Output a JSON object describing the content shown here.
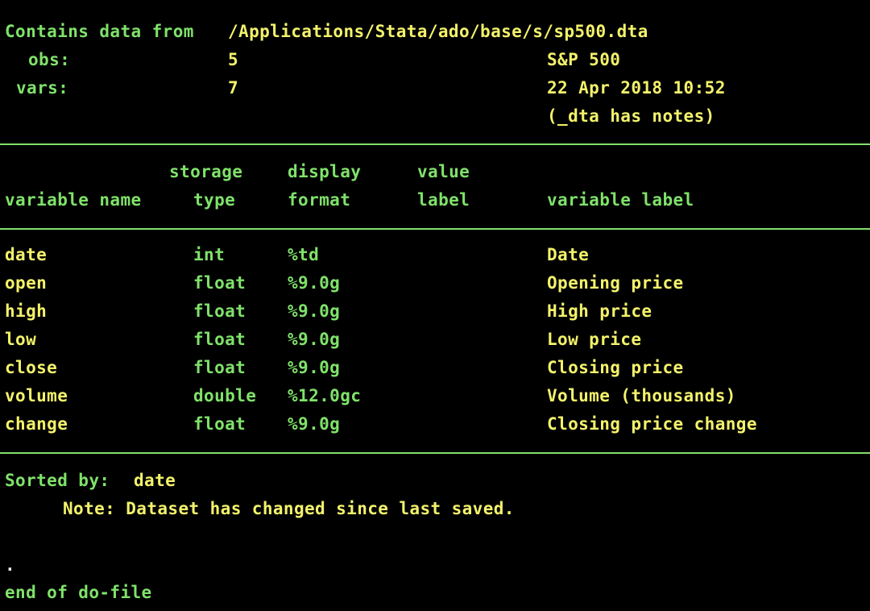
{
  "header": {
    "contains_label": "Contains data from",
    "path": "/Applications/Stata/ado/base/s/sp500.dta",
    "obs_label": "obs:",
    "obs_value": "5",
    "vars_label": "vars:",
    "vars_value": "7",
    "data_label": "S&P 500",
    "timestamp": "22 Apr 2018 10:52",
    "notes": "(_dta has notes)"
  },
  "columns": {
    "storage_top": "storage",
    "display_top": "display",
    "value_top": "value",
    "varname": "variable name",
    "type": "type",
    "format": "format",
    "vlabel": "label",
    "variable_label": "variable label"
  },
  "variables": [
    {
      "name": "date",
      "type": "int",
      "format": "%td",
      "label": "Date"
    },
    {
      "name": "open",
      "type": "float",
      "format": "%9.0g",
      "label": "Opening price"
    },
    {
      "name": "high",
      "type": "float",
      "format": "%9.0g",
      "label": "High price"
    },
    {
      "name": "low",
      "type": "float",
      "format": "%9.0g",
      "label": "Low price"
    },
    {
      "name": "close",
      "type": "float",
      "format": "%9.0g",
      "label": "Closing price"
    },
    {
      "name": "volume",
      "type": "double",
      "format": "%12.0gc",
      "label": "Volume (thousands)"
    },
    {
      "name": "change",
      "type": "float",
      "format": "%9.0g",
      "label": "Closing price change"
    }
  ],
  "footer": {
    "sorted_label": "Sorted by:",
    "sorted_value": "date",
    "note": "Note: Dataset has changed since last saved.",
    "prompt": ".",
    "end_line": "end of do-file"
  },
  "colors": {
    "background": "#000000",
    "green": "#7fe26a",
    "yellow": "#f3f26b",
    "white": "#e8e8e8"
  }
}
